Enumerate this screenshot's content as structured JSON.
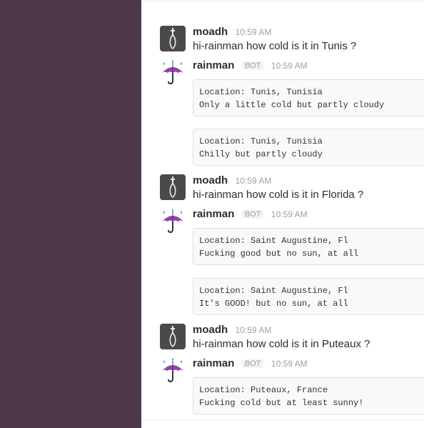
{
  "messages": [
    {
      "user": "moadh",
      "time": "10:59 AM",
      "text": "hi-rainman how cold is it in Tunis ?"
    },
    {
      "user": "rainman",
      "badge": "BOT",
      "time": "10:59 AM",
      "blocks": [
        {
          "l1": "Location: Tunis, Tunisia",
          "l2": "Only a little cold but partly cloudy"
        },
        {
          "l1": "Location: Tunis, Tunisia",
          "l2": "Chilly but partly cloudy"
        }
      ]
    },
    {
      "user": "moadh",
      "time": "10:59 AM",
      "text": "hi-rainman how cold is it in Florida ?"
    },
    {
      "user": "rainman",
      "badge": "BOT",
      "time": "10:59 AM",
      "blocks": [
        {
          "l1": "Location: Saint Augustine, Fl",
          "l2": "Fucking good but no sun, at all"
        },
        {
          "l1": "Location: Saint Augustine, Fl",
          "l2": "It's GOOD! but no sun, at all"
        }
      ]
    },
    {
      "user": "moadh",
      "time": "10:59 AM",
      "text": "hi-rainman how cold is it in Puteaux ?"
    },
    {
      "user": "rainman",
      "badge": "BOT",
      "time": "10:59 AM",
      "blocks": [
        {
          "l1": "Location: Puteaux, France",
          "l2": "Fucking cold but at least sunny!"
        }
      ]
    }
  ]
}
